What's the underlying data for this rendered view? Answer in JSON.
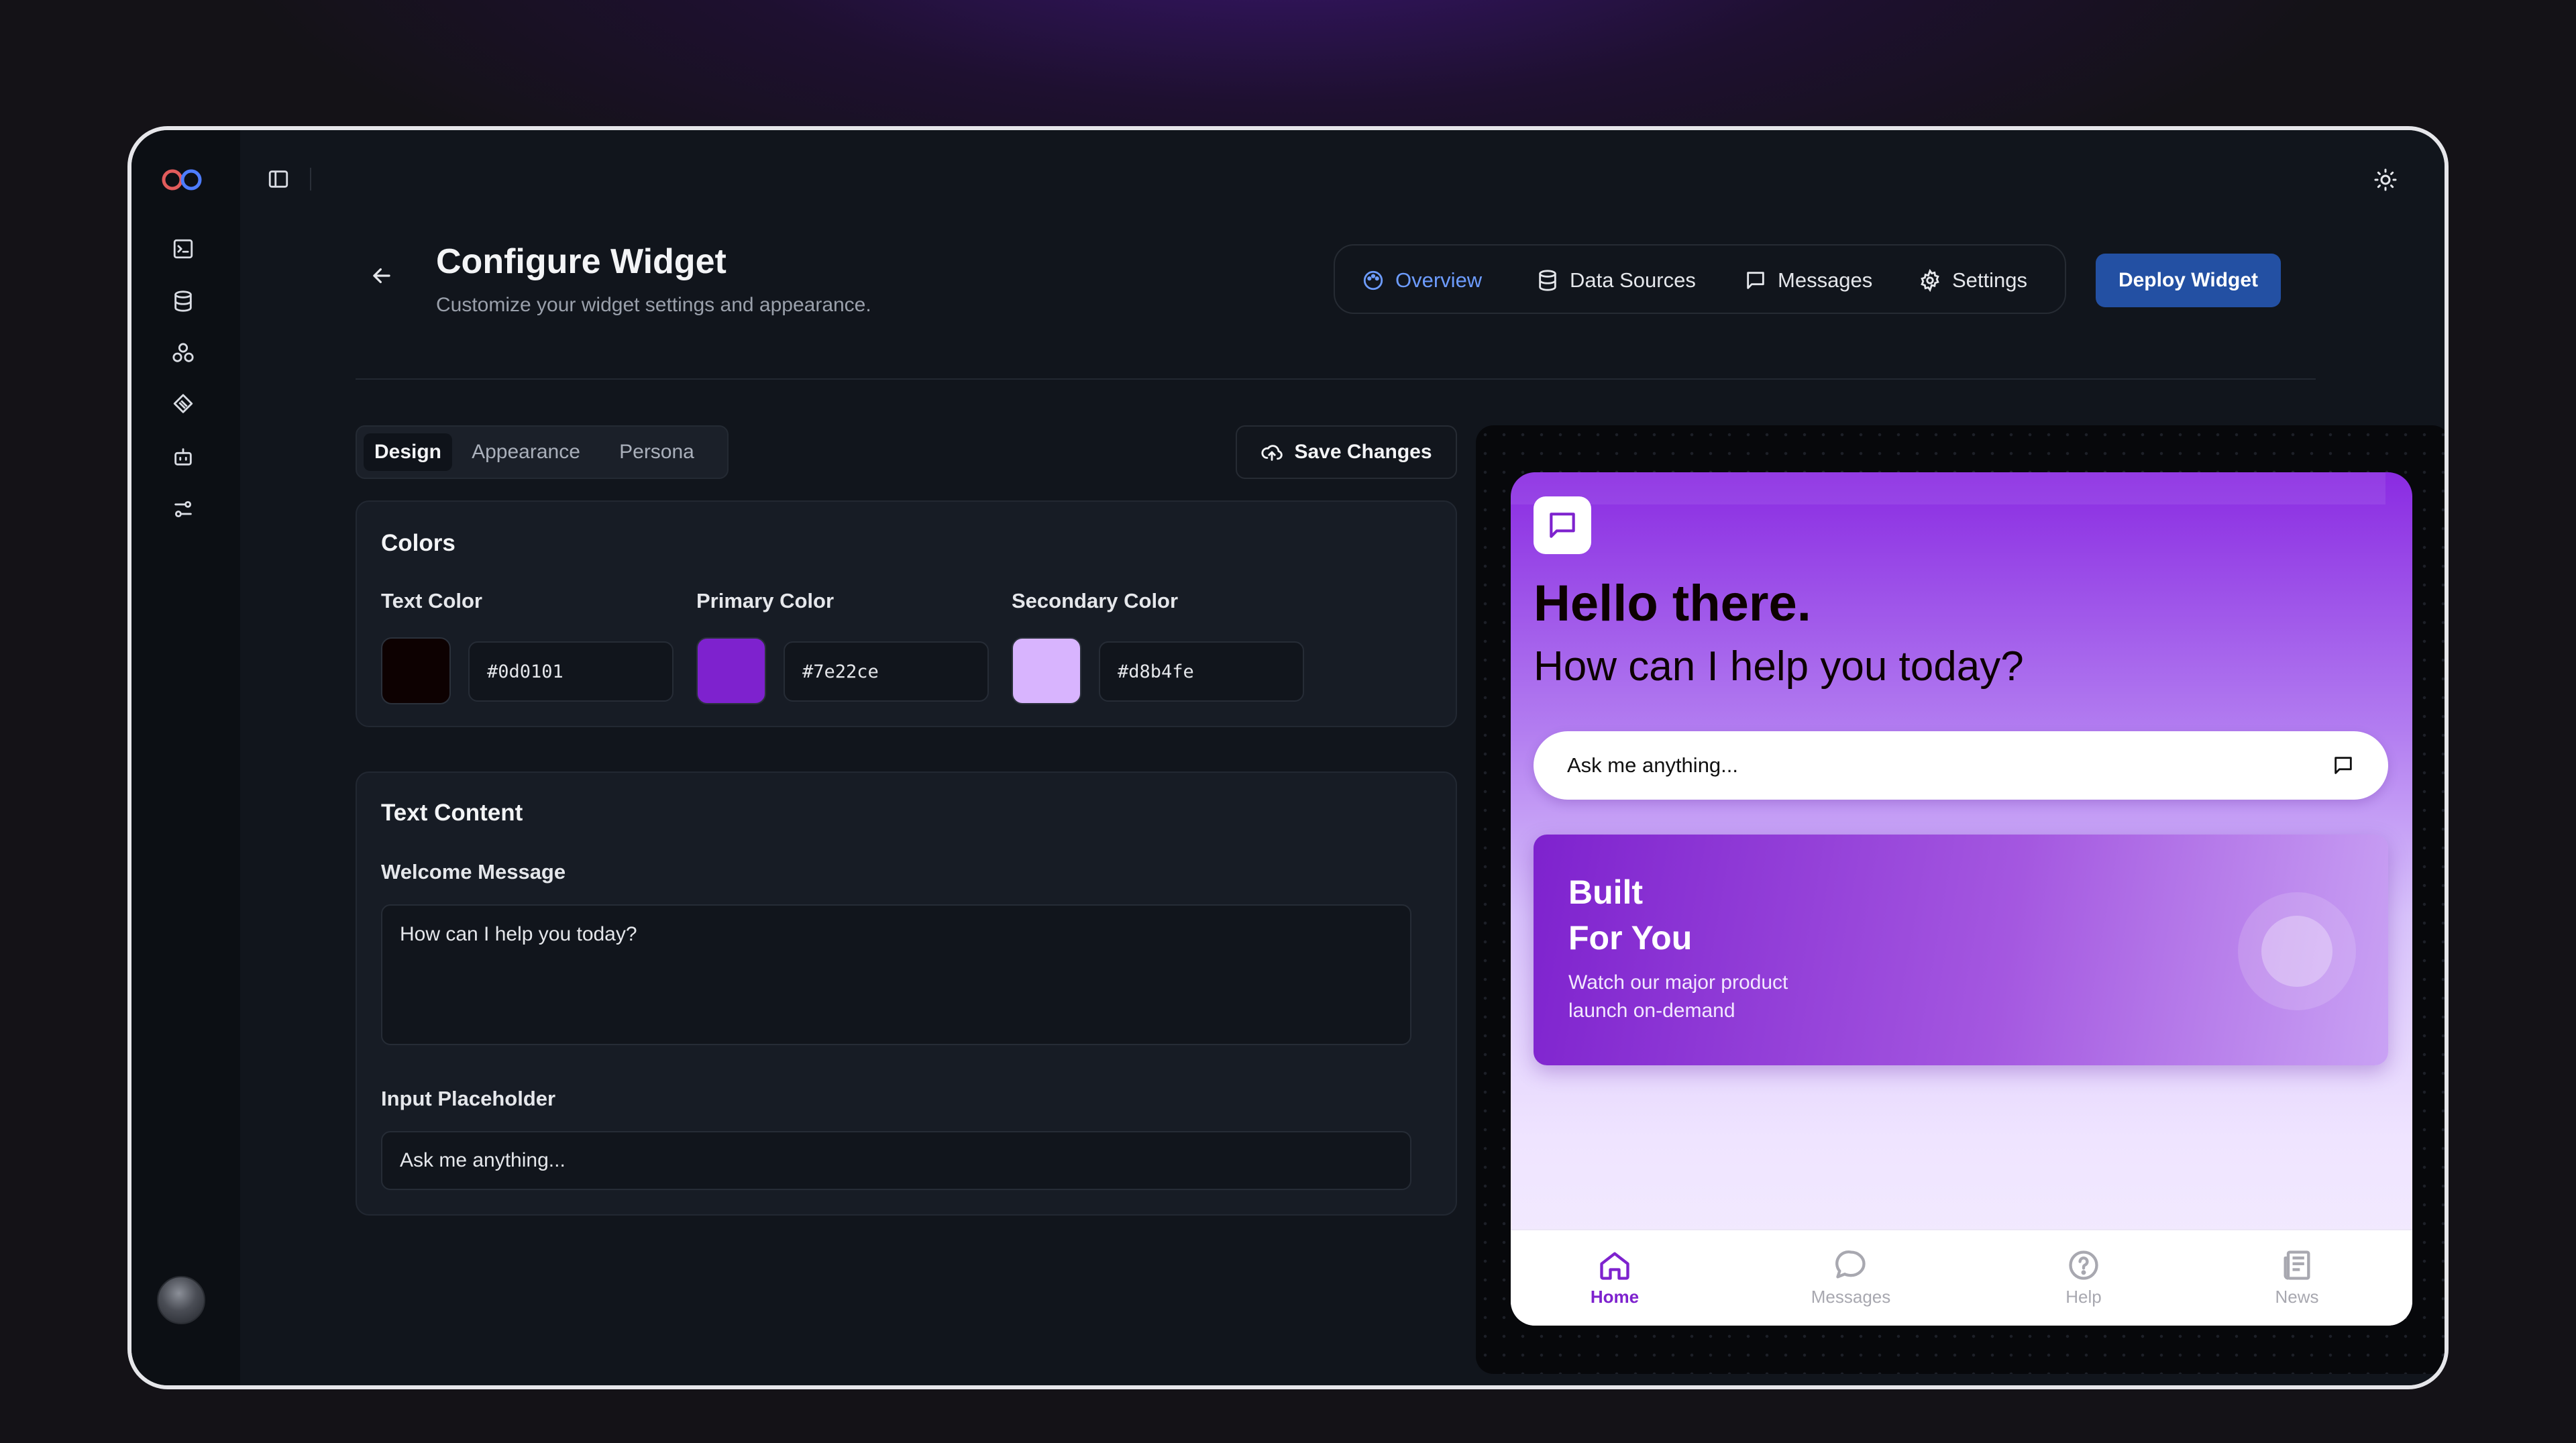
{
  "topbar": {
    "toggle_icon": "sidebar-toggle-icon",
    "theme_icon": "sun-icon"
  },
  "rail": {
    "icons": [
      "terminal-icon",
      "database-icon",
      "components-icon",
      "integrations-icon",
      "bot-icon",
      "sliders-icon"
    ]
  },
  "header": {
    "title": "Configure Widget",
    "subtitle": "Customize your widget settings and appearance."
  },
  "nav": {
    "items": [
      {
        "label": "Overview",
        "icon": "palette-icon",
        "active": true
      },
      {
        "label": "Data Sources",
        "icon": "database-icon"
      },
      {
        "label": "Messages",
        "icon": "message-icon"
      },
      {
        "label": "Settings",
        "icon": "gear-icon"
      }
    ],
    "deploy_label": "Deploy Widget"
  },
  "tabs": [
    {
      "label": "Design",
      "active": true
    },
    {
      "label": "Appearance"
    },
    {
      "label": "Persona"
    }
  ],
  "save_label": "Save Changes",
  "colors": {
    "title": "Colors",
    "fields": [
      {
        "label": "Text Color",
        "value": "#0d0101"
      },
      {
        "label": "Primary Color",
        "value": "#7e22ce"
      },
      {
        "label": "Secondary Color",
        "value": "#d8b4fe"
      }
    ]
  },
  "text_content": {
    "title": "Text Content",
    "welcome_label": "Welcome Message",
    "welcome_value": "How can I help you today?",
    "placeholder_label": "Input Placeholder",
    "placeholder_value": "Ask me anything..."
  },
  "preview": {
    "greeting": "Hello there.",
    "question": "How can I help you today?",
    "input_placeholder": "Ask me anything...",
    "promo_title_1": "Built",
    "promo_title_2": "For You",
    "promo_sub_1": "Watch our major product",
    "promo_sub_2": "launch on-demand",
    "bottom_nav": [
      {
        "label": "Home",
        "icon": "home-icon",
        "active": true
      },
      {
        "label": "Messages",
        "icon": "chat-bubble-icon"
      },
      {
        "label": "Help",
        "icon": "help-circle-icon"
      },
      {
        "label": "News",
        "icon": "newspaper-icon"
      }
    ]
  },
  "accent": {
    "primary": "#7e22ce",
    "secondary": "#d8b4fe",
    "text": "#0d0101",
    "deploy": "#2350a3",
    "nav_active": "#6d9cff"
  }
}
